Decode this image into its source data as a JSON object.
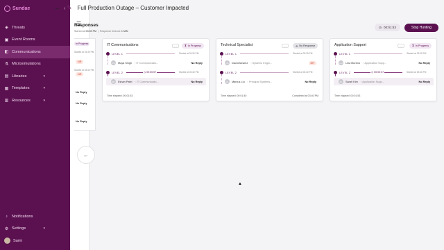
{
  "app": {
    "name": "Sundae"
  },
  "sidebar": {
    "items": [
      {
        "label": "Threats",
        "icon": "shield-icon"
      },
      {
        "label": "Event Rooms",
        "icon": "door-icon"
      },
      {
        "label": "Communications",
        "icon": "chat-icon",
        "active": true
      },
      {
        "label": "Microsimulations",
        "icon": "flask-icon"
      },
      {
        "label": "Libraries",
        "icon": "book-icon",
        "chevron": true
      },
      {
        "label": "Templates",
        "icon": "template-icon",
        "chevron": true
      },
      {
        "label": "Resources",
        "icon": "folder-icon",
        "chevron": true
      }
    ],
    "bottom": [
      {
        "label": "Notifications",
        "icon": "bell-icon"
      },
      {
        "label": "Settings",
        "icon": "gear-icon",
        "chevron": true
      },
      {
        "label": "Sami",
        "icon": "avatar"
      }
    ]
  },
  "header": {
    "title": "Full Production Outage – Customer Impacted"
  },
  "responses": {
    "title": "Responses",
    "started_prefix": "Started at",
    "started_time": "03:39 PM",
    "timeout_label": "Response timeout:",
    "timeout_value": "1 MIN",
    "elapsed_timer": "00:01:53",
    "stop_label": "Stop Hunting"
  },
  "cut_card": {
    "status": "In Progress",
    "time1": "Started at 03:39 PM",
    "time2": "Started at 03:40 PM",
    "nr1": "NR",
    "nr2": "NR",
    "reply1": "No Reply",
    "reply2": "No Reply",
    "reply3": "No Reply"
  },
  "cards": [
    {
      "title": "IT Communications",
      "status": "In Progress",
      "level1_label": "LEVEL 1",
      "level1_time": "Started at 03:39 PM",
      "level2_label": "LEVEL 2",
      "level2_timer": "00:00:07",
      "level2_time": "Started at 03:40 PM",
      "members": [
        {
          "initials": "MS",
          "name": "Maya Singh",
          "role": "IT Communicatio...",
          "status": "No Reply"
        },
        {
          "initials": "EP",
          "name": "Eshan Patel",
          "role": "IT Communicatio...",
          "status": "No Reply"
        }
      ],
      "footer_left": "Time elapsed: 00:01:53",
      "footer_right": ""
    },
    {
      "title": "Technical Specialist",
      "status": "No Response",
      "level1_label": "LEVEL 1",
      "level1_time": "Started at 03:39 PM",
      "level2_label": "LEVEL 2",
      "level2_timer": "",
      "level2_time": "Started at 03:40 PM",
      "members": [
        {
          "initials": "DA",
          "name": "David Alvarez",
          "role": "Systems Engin...",
          "status": "NR"
        },
        {
          "initials": "ML",
          "name": "Marcus Liu",
          "role": "Principal Systems...",
          "status": "No Reply"
        }
      ],
      "footer_left": "Time elapsed: 00:01:40",
      "footer_right": "Completed at 03:40 PM"
    },
    {
      "title": "Application Support",
      "status": "In Progress",
      "level1_label": "LEVEL 1",
      "level1_time": "Started at 03:39 PM",
      "level2_label": "LEVEL 2",
      "level2_timer": "00:00:07",
      "level2_time": "Started at 03:40 PM",
      "members": [
        {
          "initials": "LM",
          "name": "Lina Moreno",
          "role": "Application Supp...",
          "status": "No Reply"
        },
        {
          "initials": "SK",
          "name": "Sarah Kim",
          "role": "Application Supp...",
          "status": "No Reply"
        }
      ],
      "footer_left": "Time elapsed: 00:01:53",
      "footer_right": ""
    }
  ]
}
